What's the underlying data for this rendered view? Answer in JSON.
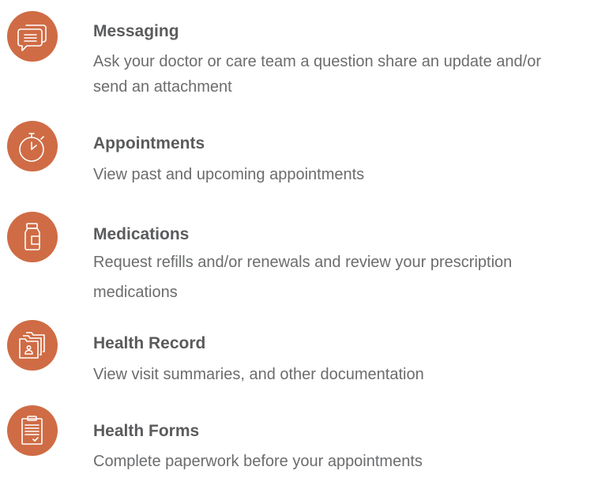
{
  "features": [
    {
      "icon": "chat-bubbles-icon",
      "title": "Messaging",
      "description": "Ask your doctor or care team a question share an update and/or send an attachment"
    },
    {
      "icon": "stopwatch-icon",
      "title": "Appointments",
      "description": "View past and upcoming appointments"
    },
    {
      "icon": "medicine-bottle-icon",
      "title": "Medications",
      "description": "Request refills and/or renewals and review your prescription medications"
    },
    {
      "icon": "folders-icon",
      "title": "Health Record",
      "description": "View visit summaries, and other documentation"
    },
    {
      "icon": "clipboard-icon",
      "title": "Health Forms",
      "description": "Complete paperwork before your appointments"
    }
  ],
  "colors": {
    "accent": "#cf6c45",
    "title": "#5a5b5d",
    "text": "#6b6c6e"
  }
}
